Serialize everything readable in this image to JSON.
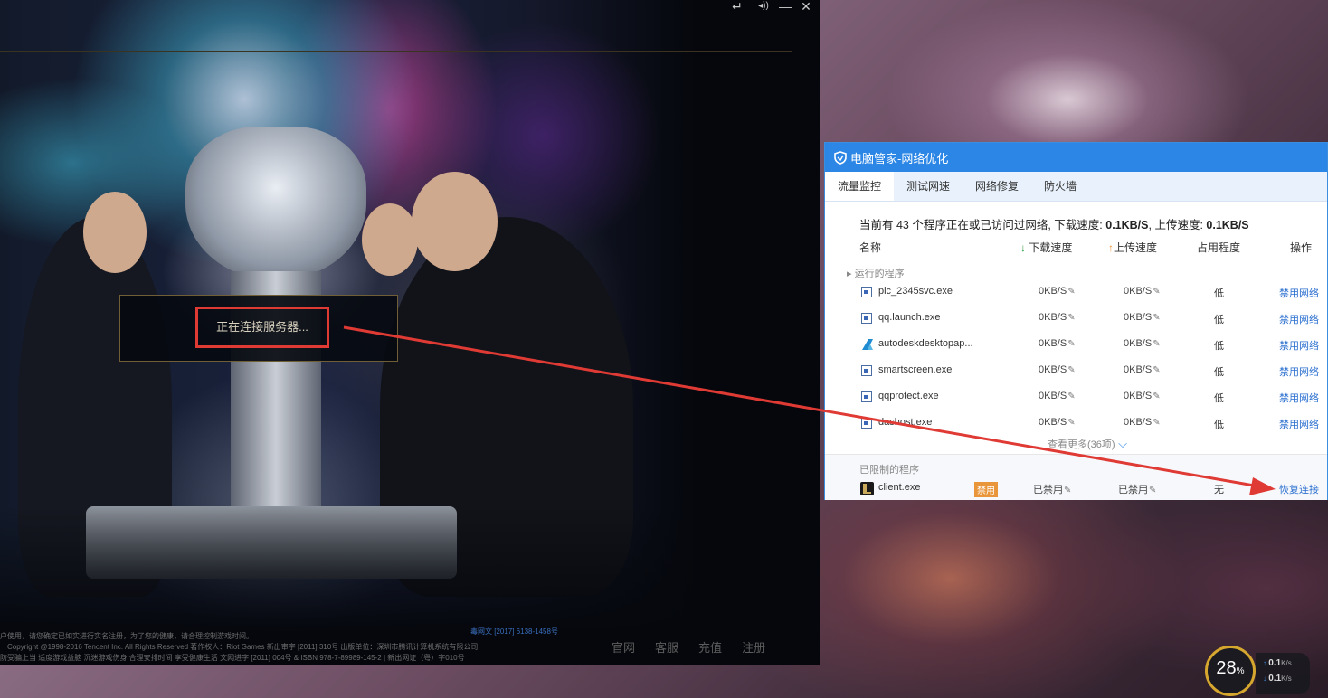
{
  "client": {
    "controls": [
      "↵",
      "◂))",
      "—",
      "✕"
    ],
    "connecting_text": "正在连接服务器...",
    "legal_lines": [
      "户使用，请您确定已如实进行实名注册，为了您的健康，请合理控制游戏时间。",
      "Copyright @1998-2016 Tencent Inc. All Rights Reserved 著作权人：Riot Games 新出审字 [2011] 310号 出版单位：深圳市腾讯计算机系统有限公司",
      "防受骗上当 适度游戏益脑 沉迷游戏伤身 合理安排时间 享受健康生活 文网进字 [2011] 004号 & ISBN 978-7-89989-145-2 | 新出网证（粤）字010号"
    ],
    "license_code": "毒网文 [2017] 6138-1458号",
    "footer_links": [
      "官网",
      "客服",
      "充值",
      "注册"
    ]
  },
  "netwin": {
    "title": "电脑管家-网络优化",
    "tabs": [
      "流量监控",
      "测试网速",
      "网络修复",
      "防火墙"
    ],
    "summary": {
      "prefix": "当前有 43 个程序正在或已访问过网络, 下载速度: ",
      "down": "0.1KB/S",
      "mid": ", 上传速度: ",
      "up": "0.1KB/S"
    },
    "columns": {
      "name": "名称",
      "down": "下载速度",
      "up": "上传速度",
      "occupy": "占用程度",
      "action": "操作"
    },
    "running_group": "运行的程序",
    "running": [
      {
        "name": "pic_2345svc.exe",
        "down": "0KB/S",
        "up": "0KB/S",
        "occupy": "低",
        "action": "禁用网络"
      },
      {
        "name": "qq.launch.exe",
        "down": "0KB/S",
        "up": "0KB/S",
        "occupy": "低",
        "action": "禁用网络"
      },
      {
        "name": "autodeskdesktopap...",
        "down": "0KB/S",
        "up": "0KB/S",
        "occupy": "低",
        "action": "禁用网络"
      },
      {
        "name": "smartscreen.exe",
        "down": "0KB/S",
        "up": "0KB/S",
        "occupy": "低",
        "action": "禁用网络"
      },
      {
        "name": "qqprotect.exe",
        "down": "0KB/S",
        "up": "0KB/S",
        "occupy": "低",
        "action": "禁用网络"
      },
      {
        "name": "dashost.exe",
        "down": "0KB/S",
        "up": "0KB/S",
        "occupy": "低",
        "action": "禁用网络"
      }
    ],
    "more": "查看更多(36项)",
    "limited_group": "已限制的程序",
    "limited": [
      {
        "name": "client.exe",
        "badge": "禁用",
        "down": "已禁用",
        "up": "已禁用",
        "occupy": "无",
        "action": "恢复连接"
      }
    ]
  },
  "gauge": {
    "percent": "28",
    "percent_unit": "%",
    "up_speed": "0.1",
    "down_speed": "0.1",
    "speed_unit": "K/s"
  },
  "colors": {
    "accent_blue": "#2b86e6",
    "annotation_red": "#e03a35",
    "badge_orange": "#e9963a"
  }
}
